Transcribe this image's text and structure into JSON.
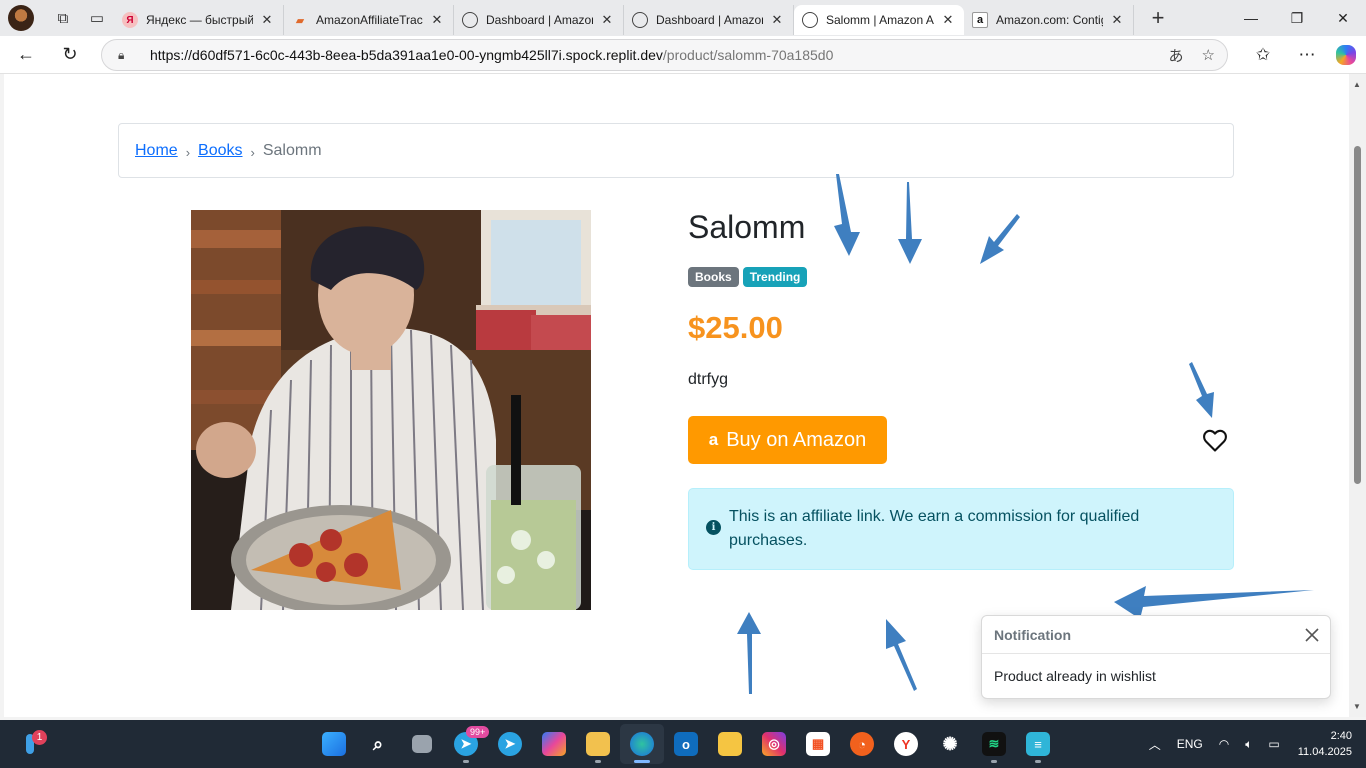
{
  "browser": {
    "tabs": [
      {
        "title": "Яндекс — быстрый",
        "favicon": "yandex"
      },
      {
        "title": "AmazonAffiliateTrack",
        "favicon": "tracker"
      },
      {
        "title": "Dashboard | Amazon",
        "favicon": "globe"
      },
      {
        "title": "Dashboard | Amazon",
        "favicon": "globe"
      },
      {
        "title": "Salomm | Amazon A",
        "favicon": "globe",
        "active": true
      },
      {
        "title": "Amazon.com: Contig",
        "favicon": "amazon"
      }
    ],
    "url_host": "https://d60df571-6c0c-443b-8eea-b5da391aa1e0-00-yngmb425ll7i.spock.replit.dev",
    "url_path": "/product/salomm-70a185d0"
  },
  "breadcrumb": {
    "home": "Home",
    "category": "Books",
    "current": "Salomm",
    "separator": "›"
  },
  "product": {
    "title": "Salomm",
    "badges": [
      "Books",
      "Trending"
    ],
    "price": "$25.00",
    "description": "dtrfyg",
    "buy_label": "Buy on Amazon",
    "affiliate_notice": "This is an affiliate link. We earn a commission for qualified purchases."
  },
  "toast": {
    "title": "Notification",
    "message": "Product already in wishlist"
  },
  "taskbar": {
    "weather_badge": "1",
    "telegram_badge": "99+",
    "language": "ENG",
    "time": "2:40",
    "date": "11.04.2025"
  },
  "colors": {
    "price": "#f7931e",
    "buy_button": "#ff9900",
    "alert_bg": "#cff4fc",
    "badge_books": "#6c757d",
    "badge_trending": "#17a2b8",
    "annotation_arrows": "#3f7fc0"
  }
}
